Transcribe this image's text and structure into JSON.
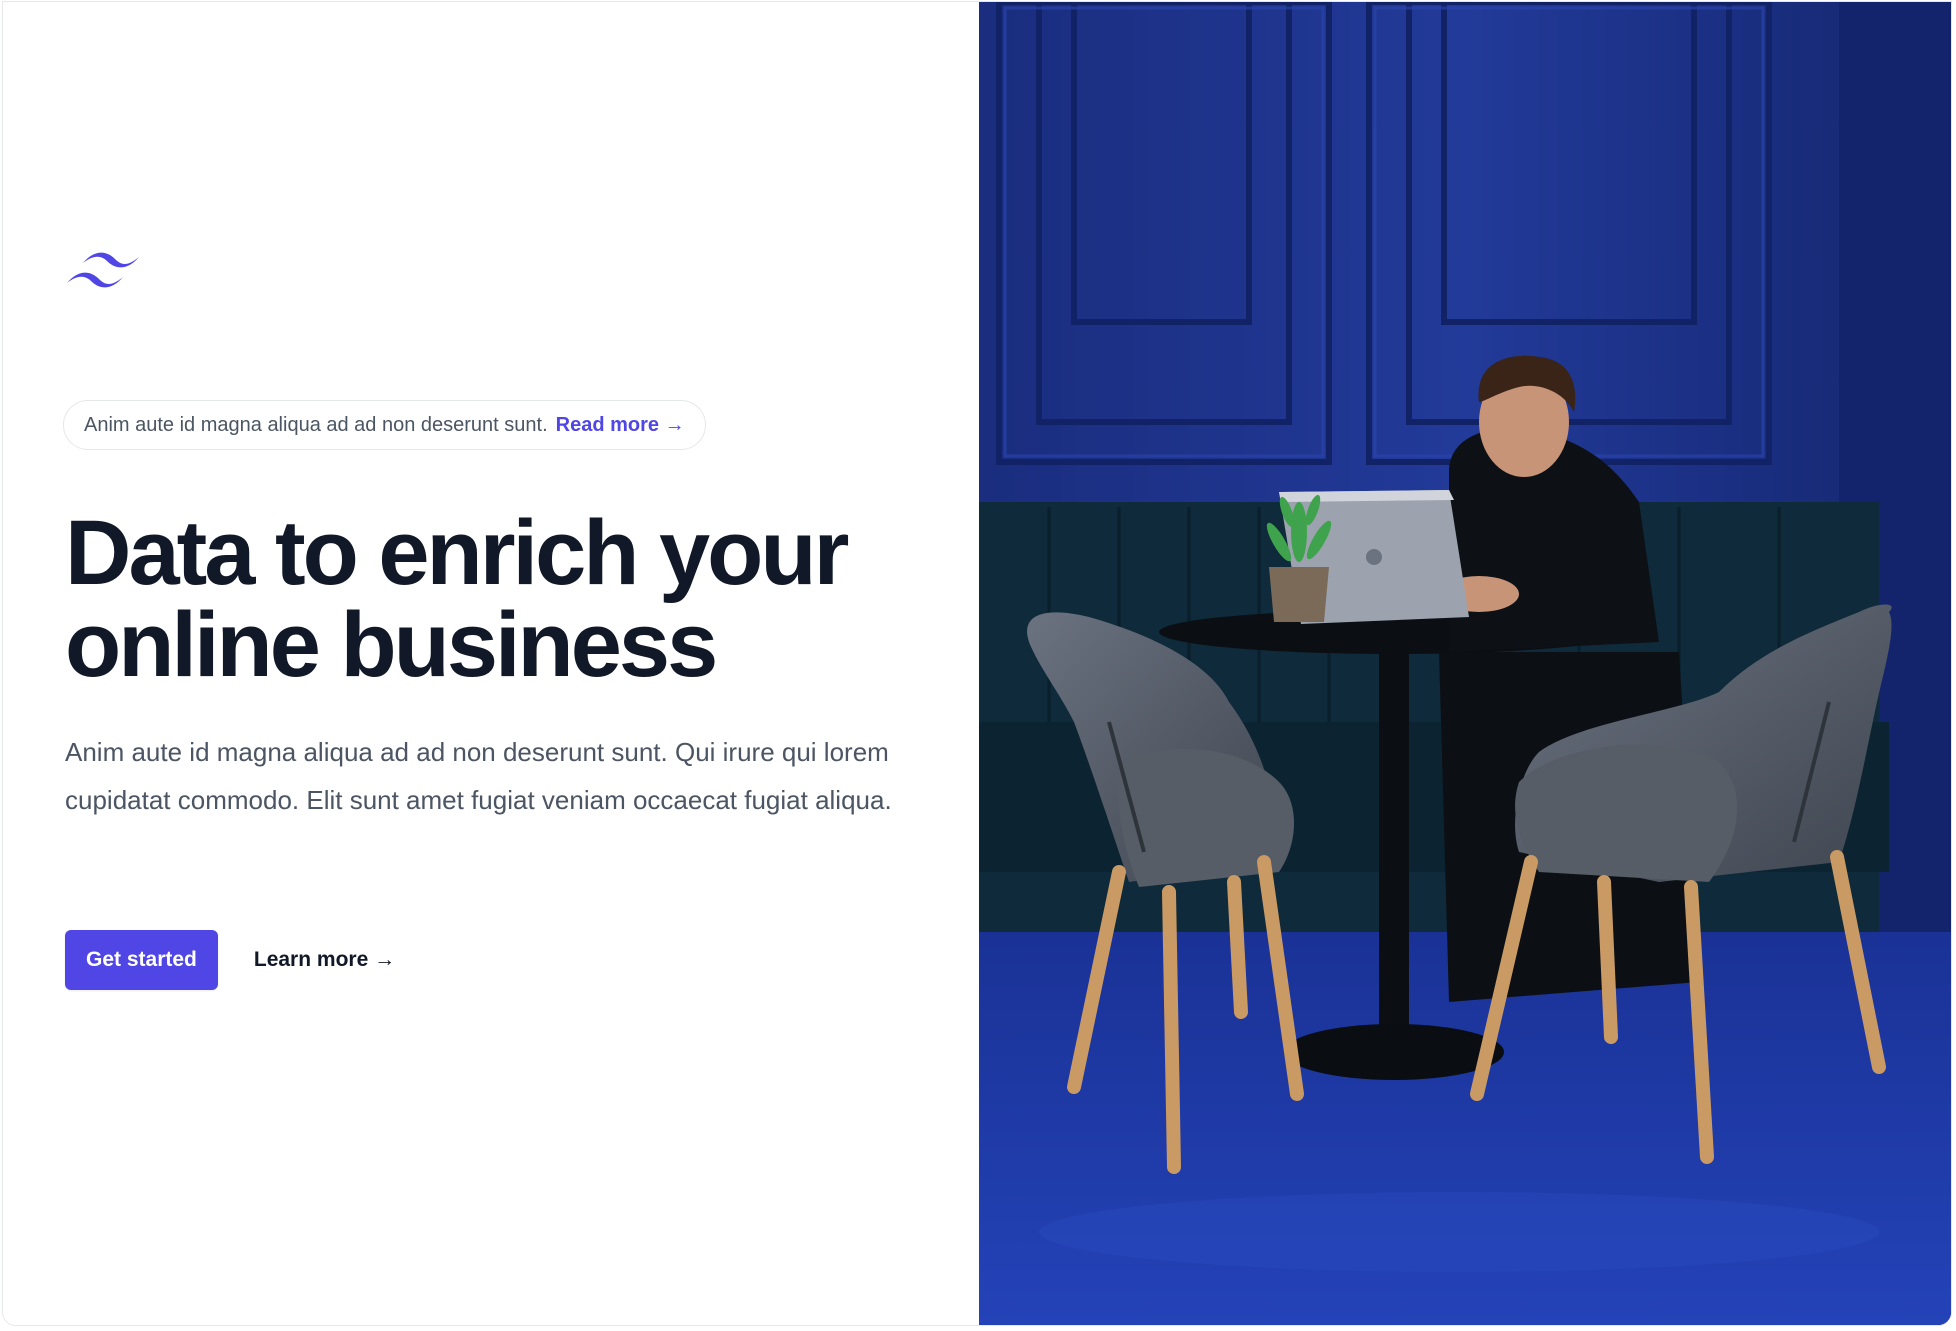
{
  "brand": {
    "logo_icon": "wave-logo-icon",
    "accent_color": "#4f46e5"
  },
  "announcement": {
    "text": "Anim aute id magna aliqua ad ad non deserunt sunt.",
    "link_label": "Read more →"
  },
  "hero": {
    "headline_line1": "Data to enrich your",
    "headline_line2": "online business",
    "description": "Anim aute id magna aliqua ad ad non deserunt sunt. Qui irure qui lorem cupidatat commodo. Elit sunt amet fugiat veniam occaecat fugiat aliqua.",
    "primary_cta": "Get started",
    "secondary_cta": "Learn more →"
  },
  "image": {
    "description_icon": "office-photo-image"
  }
}
